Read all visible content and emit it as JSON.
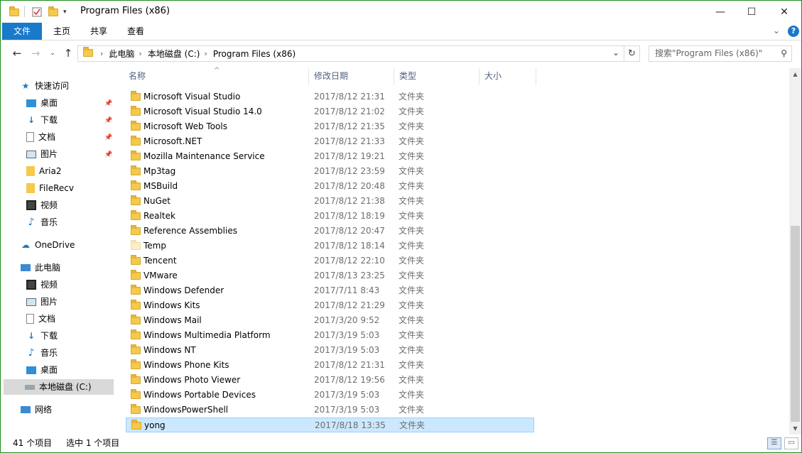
{
  "window": {
    "title": "Program Files (x86)",
    "controls": {
      "minimize": "—",
      "maximize": "☐",
      "close": "✕"
    }
  },
  "ribbon": {
    "tabs": [
      "文件",
      "主页",
      "共享",
      "查看"
    ],
    "expand": "⌄",
    "help": "?"
  },
  "address": {
    "crumbs": [
      "此电脑",
      "本地磁盘 (C:)",
      "Program Files (x86)"
    ],
    "search_placeholder": "搜索\"Program Files (x86)\""
  },
  "columns": {
    "name": "名称",
    "date": "修改日期",
    "type": "类型",
    "size": "大小"
  },
  "nav": {
    "quick_access": "快速访问",
    "quick_items": [
      "桌面",
      "下载",
      "文档",
      "图片",
      "Aria2",
      "FileRecv",
      "视频",
      "音乐"
    ],
    "onedrive": "OneDrive",
    "this_pc": "此电脑",
    "pc_items": [
      "视频",
      "图片",
      "文档",
      "下载",
      "音乐",
      "桌面",
      "本地磁盘 (C:)"
    ],
    "network": "网络"
  },
  "files": [
    {
      "name": "Microsoft Visual Studio",
      "date": "2017/8/12 21:31",
      "type": "文件夹"
    },
    {
      "name": "Microsoft Visual Studio 14.0",
      "date": "2017/8/12 21:02",
      "type": "文件夹"
    },
    {
      "name": "Microsoft Web Tools",
      "date": "2017/8/12 21:35",
      "type": "文件夹"
    },
    {
      "name": "Microsoft.NET",
      "date": "2017/8/12 21:33",
      "type": "文件夹"
    },
    {
      "name": "Mozilla Maintenance Service",
      "date": "2017/8/12 19:21",
      "type": "文件夹"
    },
    {
      "name": "Mp3tag",
      "date": "2017/8/12 23:59",
      "type": "文件夹"
    },
    {
      "name": "MSBuild",
      "date": "2017/8/12 20:48",
      "type": "文件夹"
    },
    {
      "name": "NuGet",
      "date": "2017/8/12 21:38",
      "type": "文件夹"
    },
    {
      "name": "Realtek",
      "date": "2017/8/12 18:19",
      "type": "文件夹"
    },
    {
      "name": "Reference Assemblies",
      "date": "2017/8/12 20:47",
      "type": "文件夹"
    },
    {
      "name": "Temp",
      "date": "2017/8/12 18:14",
      "type": "文件夹"
    },
    {
      "name": "Tencent",
      "date": "2017/8/12 22:10",
      "type": "文件夹"
    },
    {
      "name": "VMware",
      "date": "2017/8/13 23:25",
      "type": "文件夹"
    },
    {
      "name": "Windows Defender",
      "date": "2017/7/11 8:43",
      "type": "文件夹"
    },
    {
      "name": "Windows Kits",
      "date": "2017/8/12 21:29",
      "type": "文件夹"
    },
    {
      "name": "Windows Mail",
      "date": "2017/3/20 9:52",
      "type": "文件夹"
    },
    {
      "name": "Windows Multimedia Platform",
      "date": "2017/3/19 5:03",
      "type": "文件夹"
    },
    {
      "name": "Windows NT",
      "date": "2017/3/19 5:03",
      "type": "文件夹"
    },
    {
      "name": "Windows Phone Kits",
      "date": "2017/8/12 21:31",
      "type": "文件夹"
    },
    {
      "name": "Windows Photo Viewer",
      "date": "2017/8/12 19:56",
      "type": "文件夹"
    },
    {
      "name": "Windows Portable Devices",
      "date": "2017/3/19 5:03",
      "type": "文件夹"
    },
    {
      "name": "WindowsPowerShell",
      "date": "2017/3/19 5:03",
      "type": "文件夹"
    },
    {
      "name": "yong",
      "date": "2017/8/18 13:35",
      "type": "文件夹"
    }
  ],
  "status": {
    "count": "41 个项目",
    "selected": "选中 1 个项目"
  },
  "colors": {
    "accent": "#1979ca",
    "selection": "#cce8ff",
    "folder": "#f5c94a",
    "border": "#1a8f1a"
  }
}
